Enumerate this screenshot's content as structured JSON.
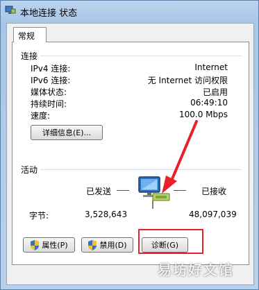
{
  "window": {
    "title": "本地连接 状态"
  },
  "tabs": [
    {
      "label": "常规"
    }
  ],
  "connection": {
    "section_label": "连接",
    "rows": [
      {
        "label": "IPv4 连接:",
        "value": "Internet"
      },
      {
        "label": "IPv6 连接:",
        "value": "无 Internet 访问权限"
      },
      {
        "label": "媒体状态:",
        "value": "已启用"
      },
      {
        "label": "持续时间:",
        "value": "06:49:10"
      },
      {
        "label": "速度:",
        "value": "100.0 Mbps"
      }
    ],
    "details_button": "详细信息(E)..."
  },
  "activity": {
    "section_label": "活动",
    "sent_label": "已发送",
    "received_label": "已接收",
    "bytes_label": "字节:",
    "bytes_sent": "3,528,643",
    "bytes_received": "48,097,039"
  },
  "buttons": {
    "properties": "属性(P)",
    "disable": "禁用(D)",
    "diagnose": "诊断(G)"
  },
  "watermark": "易坊好文馆",
  "colors": {
    "annotation_red": "#e8202a"
  }
}
